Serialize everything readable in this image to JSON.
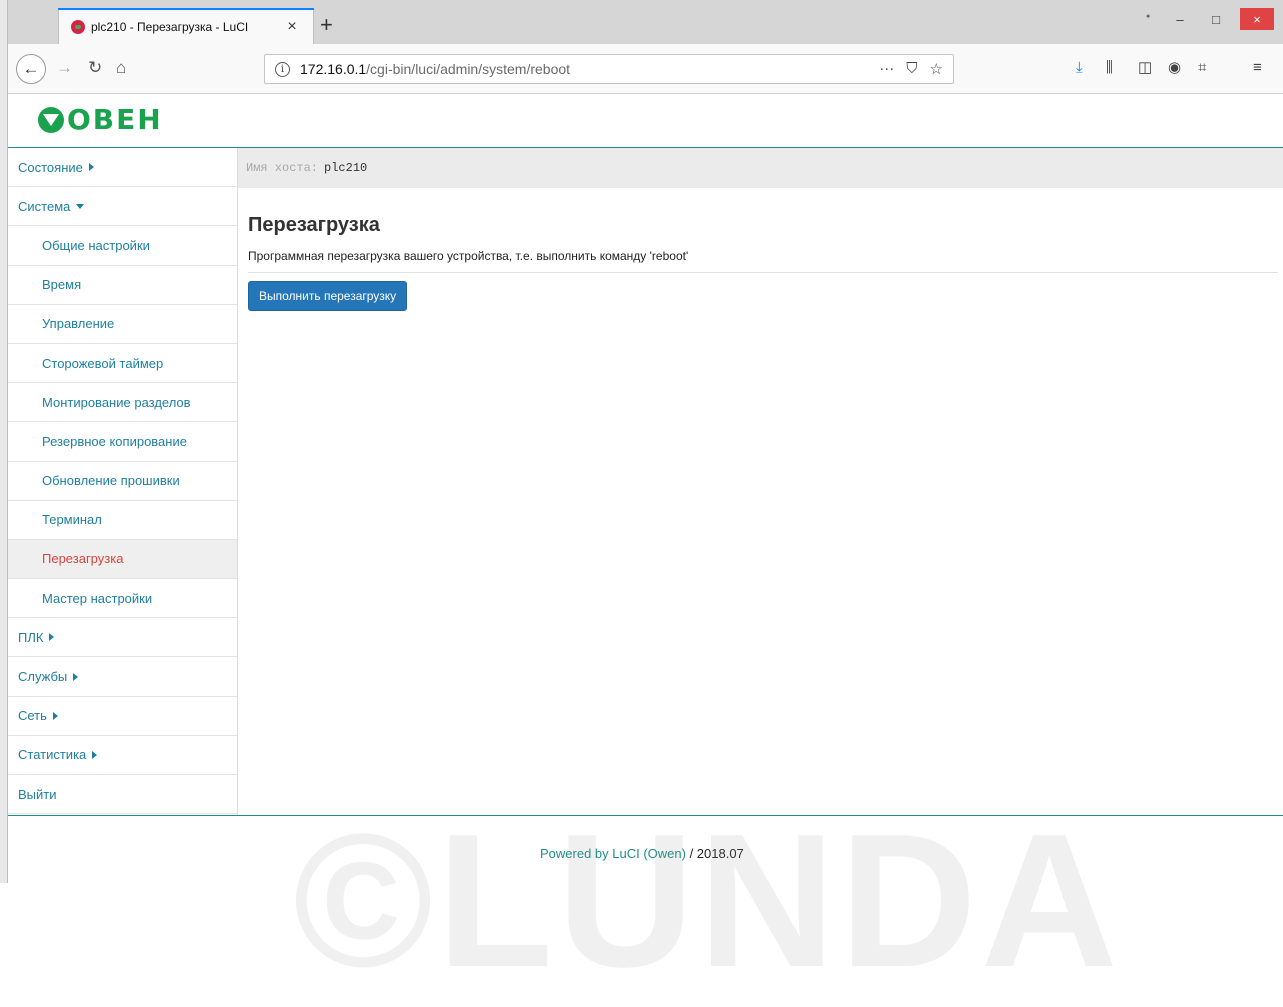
{
  "browser": {
    "tab_title": "plc210 - Перезагрузка - LuCI",
    "tab_close": "×",
    "new_tab": "+",
    "url_host": "172.16.0.1",
    "url_path": "/cgi-bin/luci/admin/system/reboot",
    "window_controls": {
      "restore": "ᐩ",
      "minimize": "–",
      "maximize": "□",
      "close": "×"
    }
  },
  "header": {
    "logo_text": "ОВЕН"
  },
  "hostbar": {
    "label": "Имя хоста:",
    "value": "plc210"
  },
  "sidebar": {
    "items": [
      {
        "label": "Состояние",
        "type": "collapsed"
      },
      {
        "label": "Система",
        "type": "expanded"
      },
      {
        "label": "Общие настройки",
        "type": "sub"
      },
      {
        "label": "Время",
        "type": "sub"
      },
      {
        "label": "Управление",
        "type": "sub"
      },
      {
        "label": "Сторожевой таймер",
        "type": "sub"
      },
      {
        "label": "Монтирование разделов",
        "type": "sub"
      },
      {
        "label": "Резервное копирование",
        "type": "sub"
      },
      {
        "label": "Обновление прошивки",
        "type": "sub"
      },
      {
        "label": "Терминал",
        "type": "sub"
      },
      {
        "label": "Перезагрузка",
        "type": "sub-active"
      },
      {
        "label": "Мастер настройки",
        "type": "sub"
      },
      {
        "label": "ПЛК",
        "type": "collapsed"
      },
      {
        "label": "Службы",
        "type": "collapsed"
      },
      {
        "label": "Сеть",
        "type": "collapsed"
      },
      {
        "label": "Статистика",
        "type": "collapsed"
      },
      {
        "label": "Выйти",
        "type": "plain"
      }
    ]
  },
  "main": {
    "title": "Перезагрузка",
    "description": "Программная перезагрузка вашего устройства, т.е. выполнить команду 'reboot'",
    "reboot_button": "Выполнить перезагрузку"
  },
  "footer": {
    "link_text": "Powered by LuCI (Owen)",
    "version": " / 2018.07"
  },
  "watermark": "©LUNDA",
  "colors": {
    "accent_link": "#1e7f9e",
    "active_item": "#d9453a",
    "button": "#2476b8",
    "brand": "#1aa24f",
    "rule": "#1e8c8c"
  }
}
